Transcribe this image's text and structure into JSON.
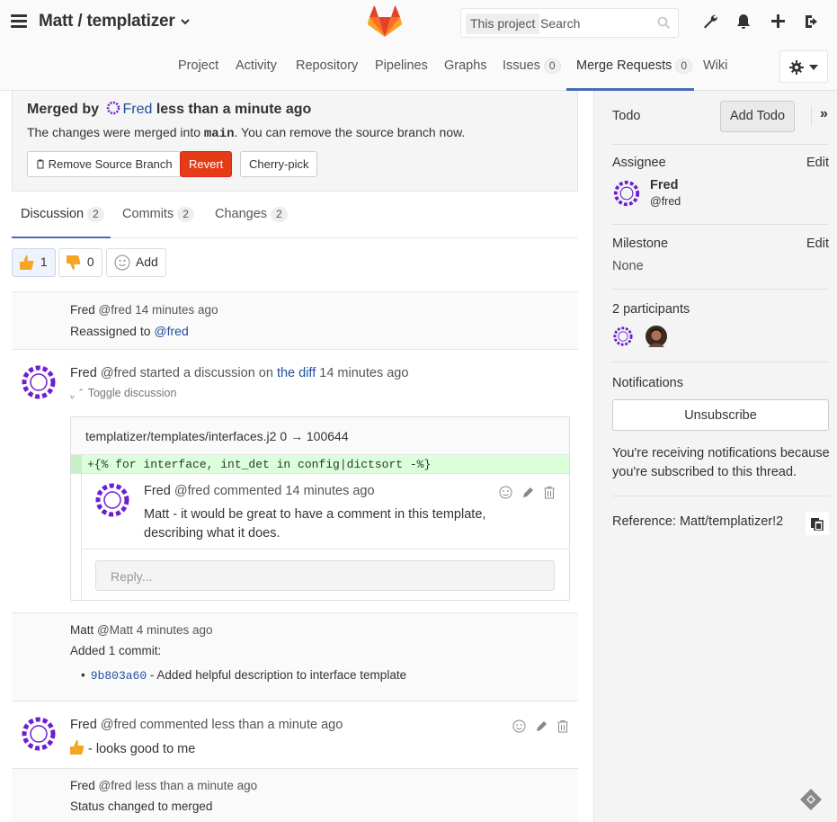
{
  "header": {
    "project_title": "Matt / templatizer",
    "search_scope": "This project",
    "search_placeholder": "Search"
  },
  "nav": {
    "tabs": [
      {
        "label": "Project"
      },
      {
        "label": "Activity"
      },
      {
        "label": "Repository"
      },
      {
        "label": "Pipelines"
      },
      {
        "label": "Graphs"
      },
      {
        "label": "Issues",
        "count": "0"
      },
      {
        "label": "Merge Requests",
        "count": "0"
      },
      {
        "label": "Wiki"
      }
    ]
  },
  "merged": {
    "prefix": "Merged by",
    "user": "Fred",
    "when": "less than a minute ago",
    "msg_pre": "The changes were merged into",
    "branch": "main",
    "msg_post": ". You can remove the source branch now.",
    "buttons": {
      "remove": "Remove Source Branch",
      "revert": "Revert",
      "cherry": "Cherry-pick"
    }
  },
  "tabs": [
    {
      "label": "Discussion",
      "count": "2"
    },
    {
      "label": "Commits",
      "count": "2"
    },
    {
      "label": "Changes",
      "count": "2"
    }
  ],
  "awards": {
    "up_count": "1",
    "down_count": "0",
    "add_label": "Add"
  },
  "events": {
    "e1": {
      "author": "Fred",
      "handle": "@fred",
      "time": "14 minutes ago",
      "text_pre": "Reassigned to ",
      "link": "@fred"
    },
    "e2": {
      "author": "Fred",
      "handle": "@fred",
      "action": "started a discussion on",
      "link": "the diff",
      "time": "14 minutes ago",
      "toggle": "Toggle discussion",
      "file": "templatizer/templates/interfaces.j2",
      "mode": "0 → 100644",
      "diff_line": "+{% for interface, int_det in config|dictsort -%}",
      "comment": {
        "author": "Fred",
        "handle": "@fred",
        "action": "commented",
        "time": "14 minutes ago",
        "body": "Matt - it would be great to have a comment in this template, describing what it does."
      },
      "reply_placeholder": "Reply..."
    },
    "e3": {
      "author": "Matt",
      "handle": "@Matt",
      "time": "4 minutes ago",
      "text": "Added 1 commit:",
      "sha": "9b803a60",
      "commit_msg": " - Added helpful description to interface template"
    },
    "e4": {
      "author": "Fred",
      "handle": "@fred",
      "action": "commented",
      "time": "less than a minute ago",
      "body": " - looks good to me"
    },
    "e5": {
      "author": "Fred",
      "handle": "@fred",
      "time": "less than a minute ago",
      "text": "Status changed to merged"
    }
  },
  "sidebar": {
    "todo_label": "Todo",
    "add_todo": "Add Todo",
    "assignee_label": "Assignee",
    "edit": "Edit",
    "assignee_name": "Fred",
    "assignee_handle": "@fred",
    "milestone_label": "Milestone",
    "milestone_value": "None",
    "participants": "2 participants",
    "notifications_label": "Notifications",
    "unsubscribe": "Unsubscribe",
    "notif_text_1": "You're receiving notifications because",
    "notif_text_2": "you're subscribed to this thread.",
    "reference": "Reference: Matt/templatizer!2"
  },
  "colors": {
    "accent": "#4a6ab8",
    "revert": "#e53b16",
    "diff_add": "#dbffdb",
    "avatar": "#6c1fd1"
  }
}
